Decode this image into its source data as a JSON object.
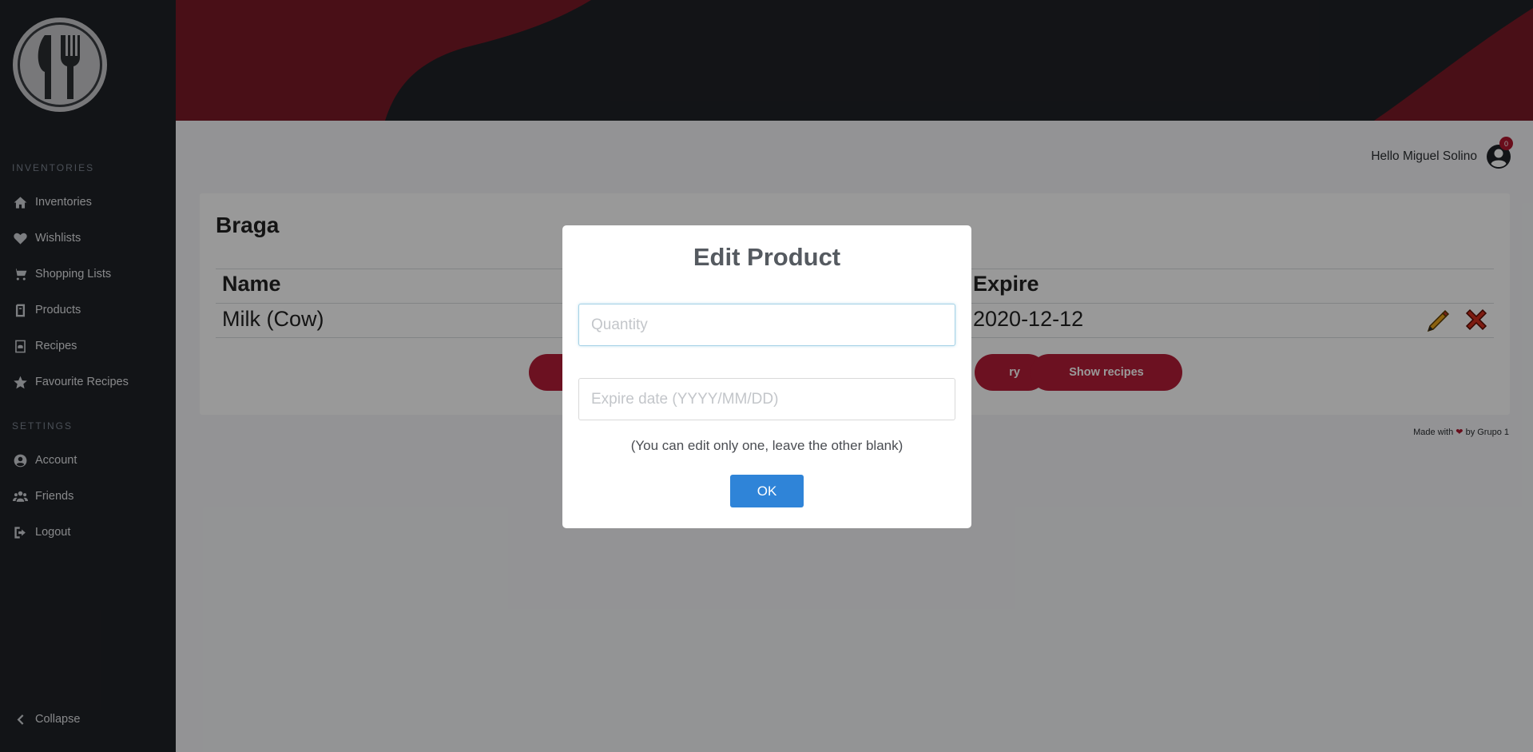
{
  "sidebar": {
    "sections": [
      {
        "title": "INVENTORIES"
      },
      {
        "title": "SETTINGS"
      }
    ],
    "items": [
      {
        "label": "Inventories",
        "icon": "home-icon"
      },
      {
        "label": "Wishlists",
        "icon": "heart-icon"
      },
      {
        "label": "Shopping Lists",
        "icon": "cart-icon"
      },
      {
        "label": "Products",
        "icon": "products-icon"
      },
      {
        "label": "Recipes",
        "icon": "recipe-book-icon"
      },
      {
        "label": "Favourite Recipes",
        "icon": "star-icon"
      },
      {
        "label": "Account",
        "icon": "user-circle-icon"
      },
      {
        "label": "Friends",
        "icon": "users-icon"
      },
      {
        "label": "Logout",
        "icon": "logout-icon"
      }
    ],
    "collapse_label": "Collapse"
  },
  "header": {
    "greeting": "Hello Miguel Solino",
    "notification_count": "0"
  },
  "inventory": {
    "title": "Braga",
    "columns": [
      "Name",
      "Expire"
    ],
    "rows": [
      {
        "name": "Milk (Cow)",
        "expire": "2020-12-12"
      }
    ],
    "buttons": {
      "left_partial": "",
      "middle_partial": "ry",
      "show_recipes": "Show recipes"
    }
  },
  "footer": {
    "made_with": "Made with",
    "by": "by Grupo 1"
  },
  "modal": {
    "title": "Edit Product",
    "quantity_placeholder": "Quantity",
    "expire_placeholder": "Expire date (YYYY/MM/DD)",
    "note": "(You can edit only one, leave the other blank)",
    "ok_label": "OK"
  },
  "colors": {
    "sidebar_bg": "#1f2227",
    "brand_red": "#b51d37",
    "ok_blue": "#2f84d8"
  }
}
